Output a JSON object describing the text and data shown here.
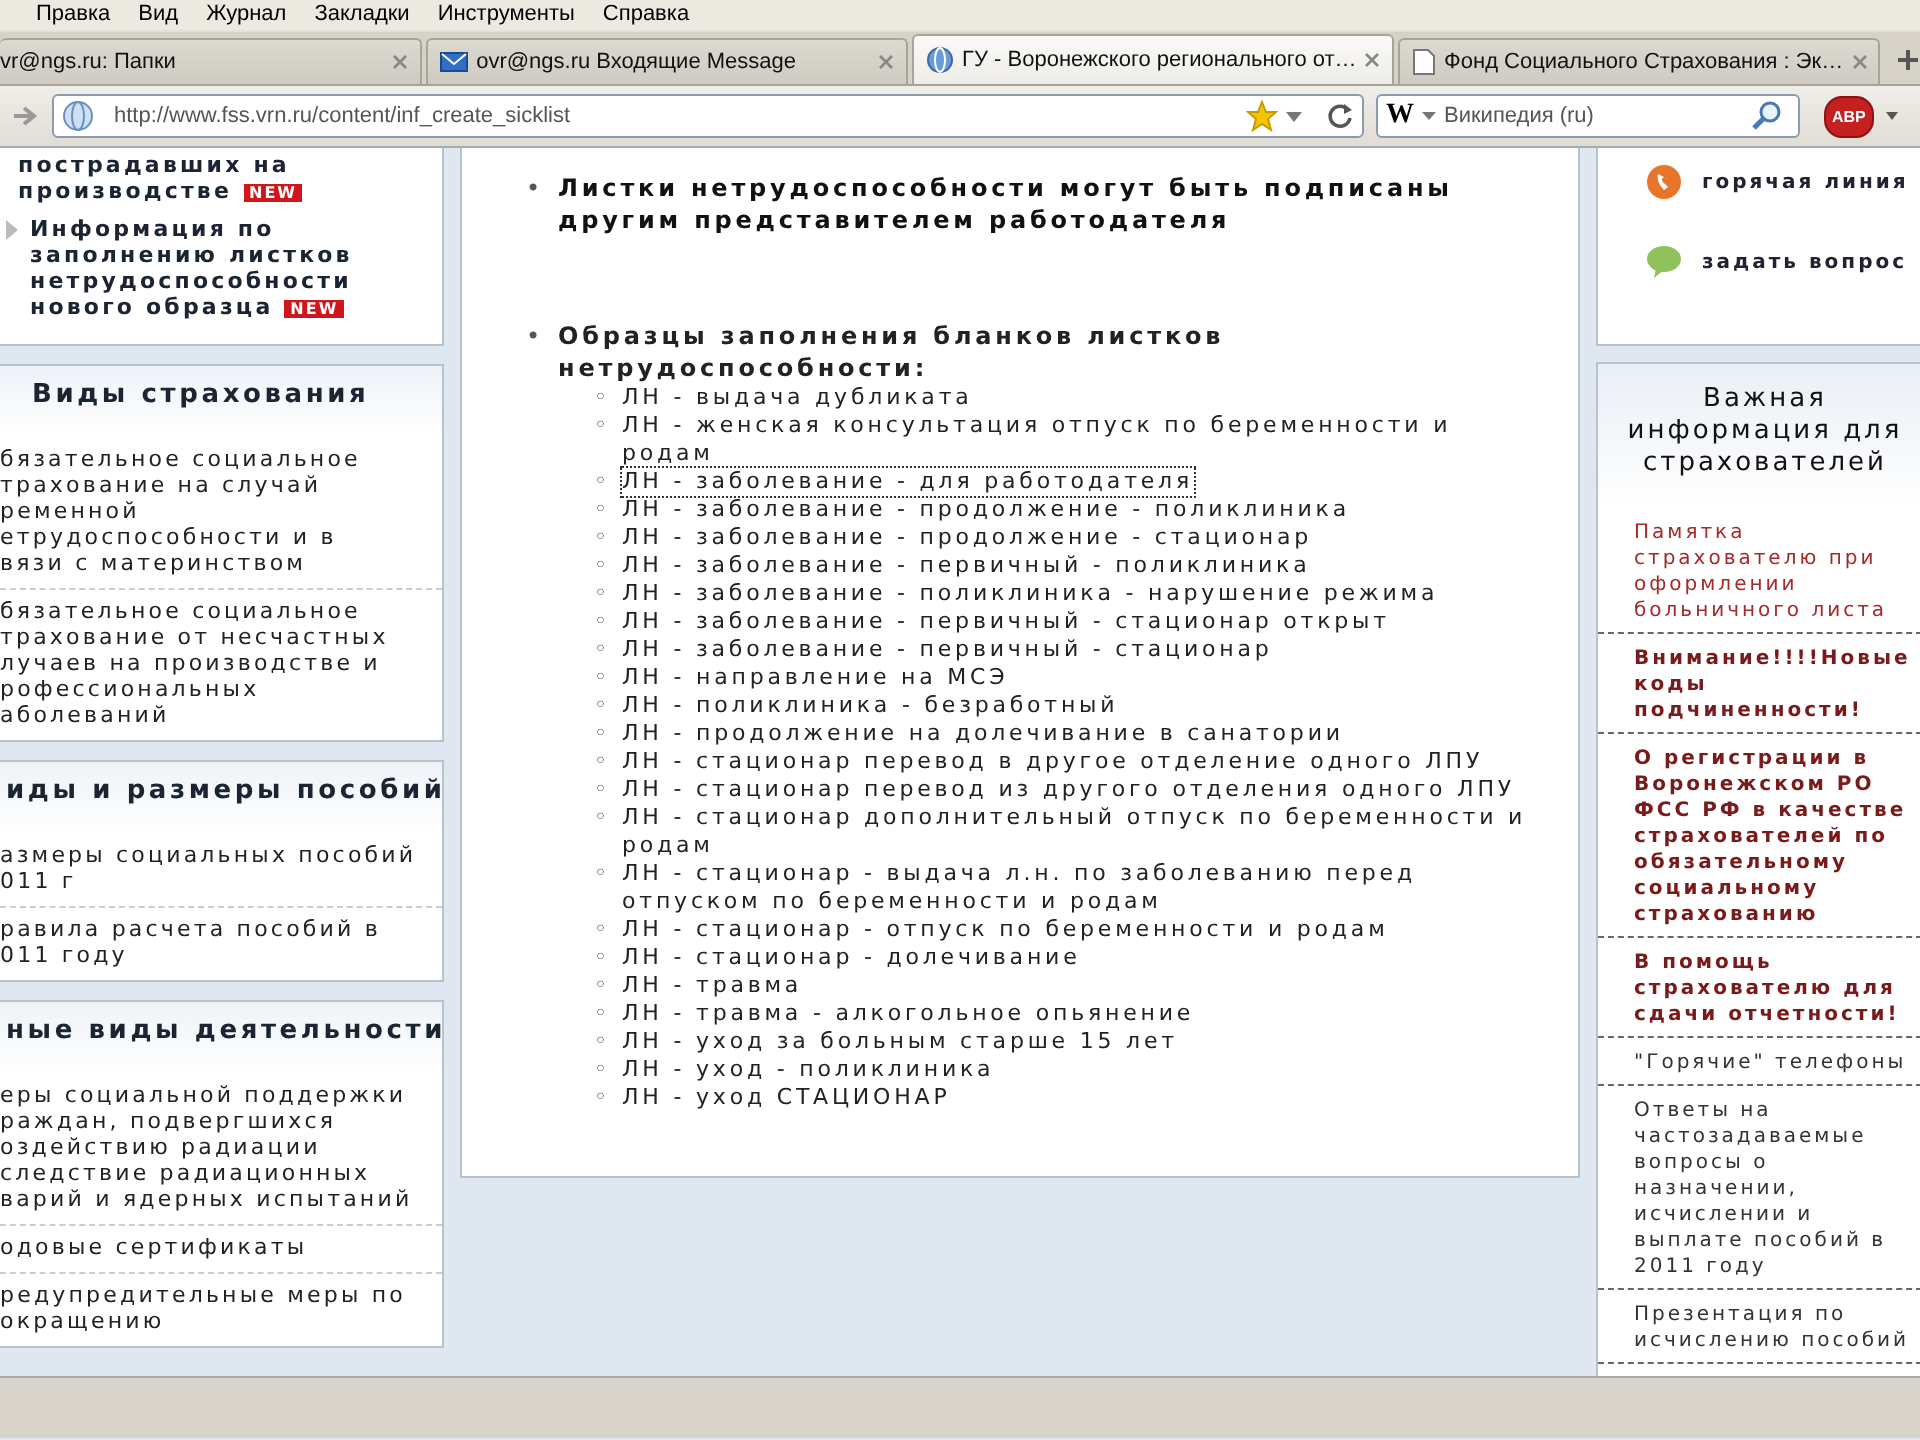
{
  "menu_bar": [
    "Правка",
    "Вид",
    "Журнал",
    "Закладки",
    "Инструменты",
    "Справка"
  ],
  "tabs": [
    {
      "title": "vr@ngs.ru: Папки",
      "kind": "none",
      "selected": false
    },
    {
      "title": "ovr@ngs.ru Входящие Message",
      "kind": "mail",
      "selected": false
    },
    {
      "title": "ГУ - Воронежского регионального от…",
      "kind": "globe",
      "selected": true
    },
    {
      "title": "Фонд Социального Страхования : Эк…",
      "kind": "page",
      "selected": false
    }
  ],
  "address_bar": {
    "url": "http://www.fss.vrn.ru/content/inf_create_sicklist"
  },
  "search_field": {
    "engine": "W",
    "placeholder": "Википедия (ru)"
  },
  "adblock_button": "ABP",
  "left_sidebar": {
    "top_links": [
      {
        "lines": [
          "пострадавших на",
          "производстве"
        ],
        "badge": "NEW",
        "arrow": false
      },
      {
        "lines": [
          "Информация по",
          "заполнению листков",
          "нетрудоспособности",
          "нового образца"
        ],
        "badge": "NEW",
        "arrow": true
      }
    ],
    "sections": [
      {
        "heading": "Виды страхования",
        "items": [
          {
            "lines": [
              "бязательное социальное",
              "трахование на случай",
              "ременной",
              "етрудоспособности и в",
              "вязи с материнством"
            ]
          },
          {
            "lines": [
              "бязательное социальное",
              "трахование от несчастных",
              "лучаев на производстве и",
              "рофессиональных",
              "аболеваний"
            ]
          }
        ]
      },
      {
        "heading": "иды и размеры пособий",
        "items": [
          {
            "lines": [
              "азмеры социальных пособий",
              "011 г"
            ]
          },
          {
            "lines": [
              "равила расчета пособий в",
              "011 году"
            ]
          }
        ]
      },
      {
        "heading": "ные виды деятельности",
        "items": [
          {
            "lines": [
              "еры социальной поддержки",
              "раждан, подвергшихся",
              "оздействию радиации",
              "следствие радиационных",
              "варий и ядерных испытаний"
            ]
          },
          {
            "lines": [
              "одовые сертификаты"
            ]
          },
          {
            "lines": [
              "редупредительные меры по",
              "окращению"
            ]
          }
        ]
      }
    ]
  },
  "main": {
    "bullets": [
      {
        "marker": "•",
        "text": "Листки нетрудоспособности могут быть подписаны другим представителем работодателя"
      },
      {
        "marker": "•",
        "text": "Образцы заполнения бланков листков нетрудоспособности:",
        "children": [
          {
            "marker": "◦",
            "text": "ЛН - выдача дубликата",
            "focused": false
          },
          {
            "marker": "◦",
            "text": "ЛН - женская консультация отпуск по беременности и родам",
            "focused": false
          },
          {
            "marker": "◦",
            "text": "ЛН - заболевание - для работодателя",
            "focused": true
          },
          {
            "marker": "◦",
            "text": "ЛН - заболевание - продолжение - поликлиника",
            "focused": false
          },
          {
            "marker": "◦",
            "text": "ЛН - заболевание - продолжение - стационар",
            "focused": false
          },
          {
            "marker": "◦",
            "text": "ЛН - заболевание - первичный - поликлиника",
            "focused": false
          },
          {
            "marker": "◦",
            "text": "ЛН - заболевание - поликлиника - нарушение режима",
            "focused": false
          },
          {
            "marker": "◦",
            "text": "ЛН - заболевание - первичный - стационар открыт",
            "focused": false
          },
          {
            "marker": "◦",
            "text": "ЛН - заболевание - первичный - стационар",
            "focused": false
          },
          {
            "marker": "◦",
            "text": "ЛН - направление на МСЭ",
            "focused": false
          },
          {
            "marker": "◦",
            "text": "ЛН - поликлиника - безработный",
            "focused": false
          },
          {
            "marker": "◦",
            "text": "ЛН - продолжение на долечивание в санатории",
            "focused": false
          },
          {
            "marker": "◦",
            "text": "ЛН - стационар перевод в другое отделение одного ЛПУ",
            "focused": false
          },
          {
            "marker": "◦",
            "text": "ЛН - стационар перевод из другого отделения одного ЛПУ",
            "focused": false
          },
          {
            "marker": "◦",
            "text": "ЛН - стационар дополнительный отпуск по беременности и родам",
            "focused": false
          },
          {
            "marker": "◦",
            "text": "ЛН - стационар - выдача л.н. по заболеванию перед отпуском по беременности и родам",
            "focused": false
          },
          {
            "marker": "◦",
            "text": "ЛН - стационар - отпуск по беременности и родам",
            "focused": false
          },
          {
            "marker": "◦",
            "text": "ЛН - стационар - долечивание",
            "focused": false
          },
          {
            "marker": "◦",
            "text": "ЛН - травма",
            "focused": false
          },
          {
            "marker": "◦",
            "text": "ЛН - травма - алкогольное опьянение",
            "focused": false
          },
          {
            "marker": "◦",
            "text": "ЛН - уход за больным старше 15 лет",
            "focused": false
          },
          {
            "marker": "◦",
            "text": "ЛН - уход - поликлиника",
            "focused": false
          },
          {
            "marker": "◦",
            "text": "ЛН - уход СТАЦИОНАР",
            "focused": false
          }
        ]
      }
    ]
  },
  "right_sidebar": {
    "quick_links": [
      {
        "label": "горячая линия",
        "kind": "phone"
      },
      {
        "label": "задать вопрос",
        "kind": "chat"
      }
    ],
    "info": {
      "heading": "Важная информация для страхователей",
      "items": [
        {
          "text": "Памятка страхователю при оформлении больничного листа",
          "bold": false,
          "color": "#a52a2a"
        },
        {
          "text": "Внимание!!!!Новые коды подчиненности!",
          "bold": true,
          "color": "#7a1a1a"
        },
        {
          "text": "О регистрации в Воронежском РО ФСС РФ в качестве страхователей по обязательному социальному страхованию",
          "bold": true,
          "color": "#7a1a1a"
        },
        {
          "text": "В помощь страхователю для сдачи отчетности!",
          "bold": true,
          "color": "#7a1a1a"
        },
        {
          "text": "\"Горячие\" телефоны",
          "bold": false,
          "color": "#333333"
        },
        {
          "text": "Ответы на частозадаваемые вопросы о назначении, исчислении и выплате пособий в 2011 году",
          "bold": false,
          "color": "#333333"
        },
        {
          "text": "Презентация по исчислению пособий",
          "bold": false,
          "color": "#333333"
        }
      ]
    }
  }
}
